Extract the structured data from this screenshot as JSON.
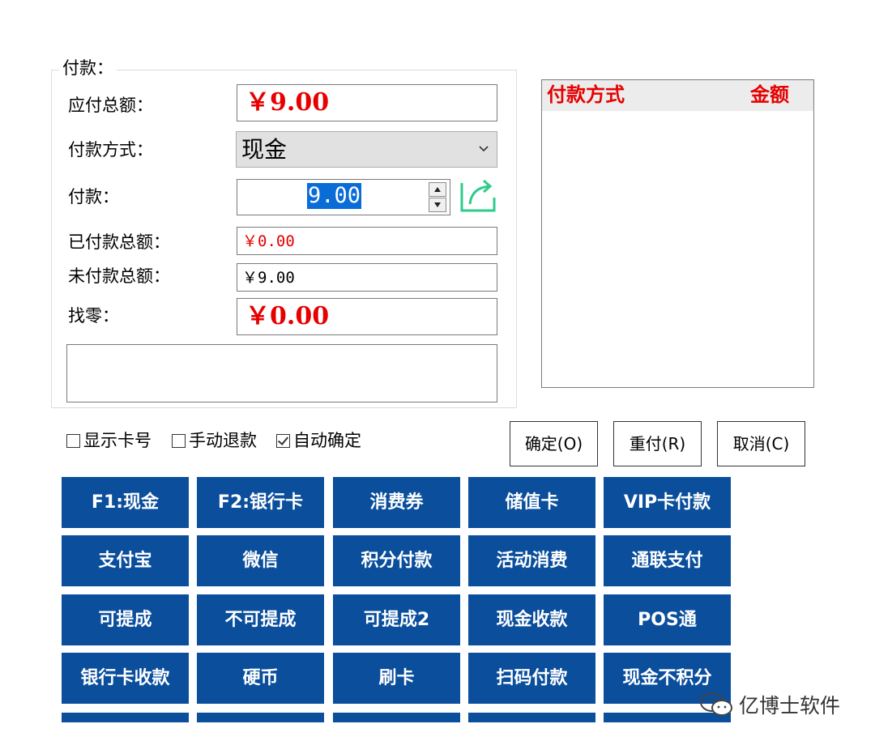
{
  "group": {
    "title": "付款："
  },
  "labels": {
    "total_due": "应付总额：",
    "method": "付款方式：",
    "pay": "付款：",
    "paid_total": "已付款总额：",
    "unpaid_total": "未付款总额：",
    "change": "找零："
  },
  "fields": {
    "total_due": "￥9.00",
    "method_selected": "现金",
    "pay_value": "9.00",
    "paid_total": "￥0.00",
    "unpaid_total": "￥9.00",
    "change": "￥0.00",
    "note": ""
  },
  "list": {
    "col_method": "付款方式",
    "col_amount": "金额"
  },
  "checkboxes": [
    {
      "label": "显示卡号",
      "checked": false
    },
    {
      "label": "手动退款",
      "checked": false
    },
    {
      "label": "自动确定",
      "checked": true
    }
  ],
  "buttons": {
    "confirm": "确定(O)",
    "repay": "重付(R)",
    "cancel": "取消(C)"
  },
  "tiles": [
    "F1:现金",
    "F2:银行卡",
    "消费券",
    "储值卡",
    "VIP卡付款",
    "支付宝",
    "微信",
    "积分付款",
    "活动消费",
    "通联支付",
    "可提成",
    "不可提成",
    "可提成2",
    "现金收款",
    "POS通",
    "银行卡收款",
    "硬币",
    "刷卡",
    "扫码付款",
    "现金不积分"
  ],
  "watermark": {
    "text": "亿博士软件",
    "icon": "wechat-icon"
  },
  "colors": {
    "tile_bg": "#0a4e9c",
    "accent_red": "#e60000",
    "go_icon": "#2ecc8a"
  }
}
